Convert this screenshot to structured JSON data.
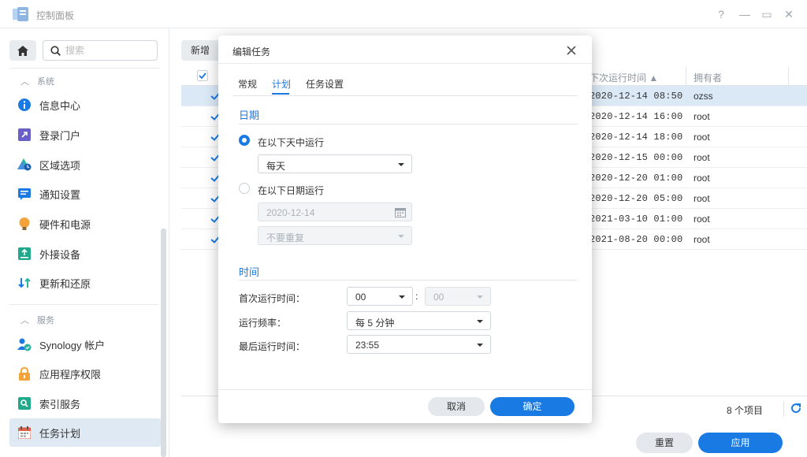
{
  "window": {
    "title": "控制面板",
    "controls": [
      "?",
      "—",
      "▭",
      "✕"
    ]
  },
  "sidebar": {
    "search_placeholder": "搜索",
    "sections": [
      {
        "label": "系统",
        "items": [
          {
            "label": "信息中心",
            "icon": "info-icon"
          },
          {
            "label": "登录门户",
            "icon": "login-portal-icon"
          },
          {
            "label": "区域选项",
            "icon": "region-icon"
          },
          {
            "label": "通知设置",
            "icon": "notification-icon"
          },
          {
            "label": "硬件和电源",
            "icon": "bulb-icon"
          },
          {
            "label": "外接设备",
            "icon": "external-device-icon"
          },
          {
            "label": "更新和还原",
            "icon": "update-icon"
          }
        ]
      },
      {
        "label": "服务",
        "items": [
          {
            "label": "Synology 帐户",
            "icon": "account-icon"
          },
          {
            "label": "应用程序权限",
            "icon": "lock-icon"
          },
          {
            "label": "索引服务",
            "icon": "index-icon"
          },
          {
            "label": "任务计划",
            "icon": "calendar-icon",
            "active": true
          }
        ]
      }
    ]
  },
  "main": {
    "toolbar_add": "新增",
    "columns": {
      "next_run": "下次运行时间 ▲",
      "owner": "拥有者"
    },
    "rows": [
      {
        "next_run": "2020-12-14 08:50",
        "owner": "ozss",
        "selected": true
      },
      {
        "next_run": "2020-12-14 16:00",
        "owner": "root"
      },
      {
        "next_run": "2020-12-14 18:00",
        "owner": "root"
      },
      {
        "next_run": "2020-12-15 00:00",
        "owner": "root"
      },
      {
        "next_run": "2020-12-20 01:00",
        "owner": "root"
      },
      {
        "next_run": "2020-12-20 05:00",
        "owner": "root"
      },
      {
        "next_run": "2021-03-10 01:00",
        "owner": "root"
      },
      {
        "next_run": "2021-08-20 00:00",
        "owner": "root"
      }
    ],
    "item_count": "8 个项目",
    "reset_label": "重置",
    "apply_label": "应用"
  },
  "modal": {
    "title": "编辑任务",
    "tabs": [
      "常规",
      "计划",
      "任务设置"
    ],
    "active_tab": "计划",
    "date_section": "日期",
    "radio_daily": "在以下天中运行",
    "daily_select": "每天",
    "radio_date": "在以下日期运行",
    "date_input": "2020-12-14",
    "repeat_select": "不要重复",
    "time_section": "时间",
    "first_run_label": "首次运行时间：",
    "first_run_hour": "00",
    "first_run_minute": "00",
    "frequency_label": "运行频率：",
    "frequency_value": "每 5 分钟",
    "last_run_label": "最后运行时间：",
    "last_run_value": "23:55",
    "cancel_label": "取消",
    "ok_label": "确定"
  },
  "colors": {
    "accent": "#1a7ae3",
    "selected_row": "#dbe9f7",
    "active_nav": "#dfe9f3"
  }
}
